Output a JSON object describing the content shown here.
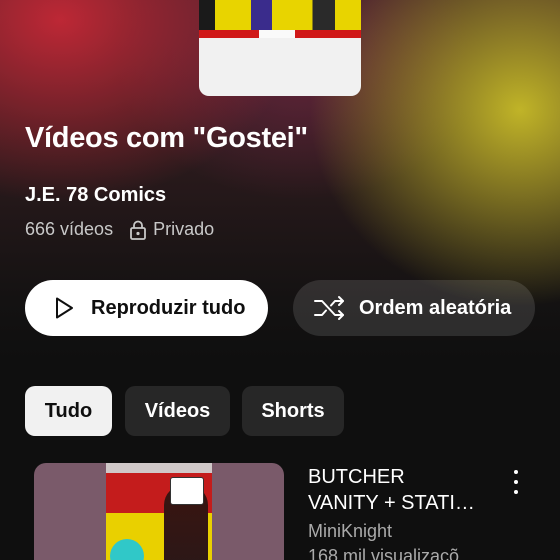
{
  "playlist": {
    "title": "Vídeos com \"Gostei\"",
    "channel": "J.E. 78 Comics",
    "video_count": "666 vídeos",
    "privacy": "Privado",
    "privacy_icon": "lock-icon"
  },
  "actions": {
    "play_all_label": "Reproduzir tudo",
    "play_icon": "play-icon",
    "shuffle_label": "Ordem aleatória",
    "shuffle_icon": "shuffle-icon"
  },
  "filters": {
    "chips": [
      "Tudo",
      "Vídeos",
      "Shorts"
    ],
    "selected": "Tudo"
  },
  "videos": [
    {
      "title_line1": "BUTCHER",
      "title_line2": "VANITY + STATI…",
      "channel": "MiniKnight",
      "views": "168 mil visualizaçõ"
    }
  ],
  "colors": {
    "active_chip_bg": "#f1f1f1",
    "chip_bg": "#272727",
    "secondary_text": "#aaaaaa"
  }
}
